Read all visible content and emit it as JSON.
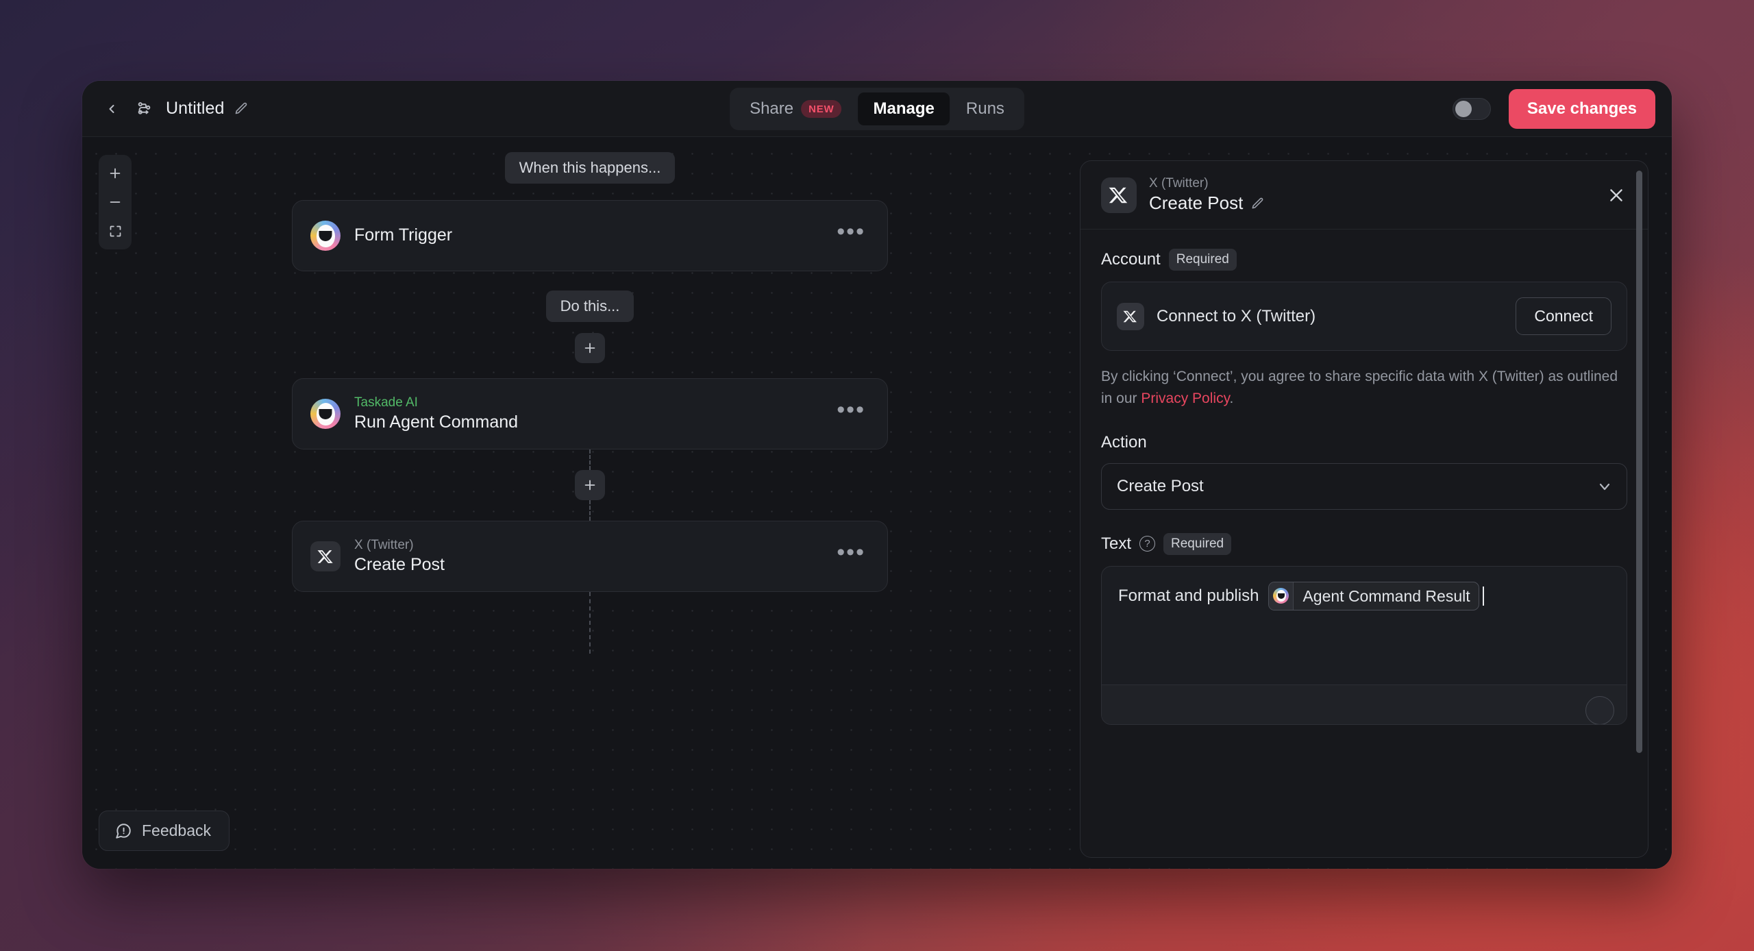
{
  "window": {
    "title": "Untitled"
  },
  "topbar": {
    "back_icon": "chevron-left-icon",
    "flow_icon": "workflow-icon",
    "title": "Untitled",
    "edit_icon": "pencil-icon",
    "tabs": [
      {
        "label": "Share",
        "badge": "NEW",
        "active": false
      },
      {
        "label": "Manage",
        "badge": "",
        "active": true
      },
      {
        "label": "Runs",
        "badge": "",
        "active": false
      }
    ],
    "toggle_state": "off",
    "save_label": "Save changes",
    "save_color": "#eb4a63"
  },
  "canvas": {
    "zoom_controls": {
      "zoom_in": "plus-icon",
      "zoom_out": "minus-icon",
      "fit_view": "fit-screen-icon"
    },
    "trigger_label": "When this happens...",
    "action_label": "Do this...",
    "nodes": [
      {
        "subtitle": "",
        "title": "Form Trigger",
        "icon": "taskade-avatar-icon",
        "menu": "•••"
      },
      {
        "subtitle": "Taskade AI",
        "subtitle_color": "#52b967",
        "title": "Run Agent Command",
        "icon": "taskade-avatar-icon",
        "menu": "•••"
      },
      {
        "subtitle": "X (Twitter)",
        "subtitle_color": "#8d9199",
        "title": "Create Post",
        "icon": "x-twitter-icon",
        "menu": "•••"
      }
    ],
    "add_step_icon": "plus-icon",
    "feedback_label": "Feedback",
    "feedback_icon": "feedback-bubble-icon"
  },
  "panel": {
    "app_name": "X (Twitter)",
    "action_title": "Create Post",
    "edit_icon": "pencil-icon",
    "close_icon": "close-icon",
    "account": {
      "label": "Account",
      "required_badge": "Required",
      "connect_row_label": "Connect to X (Twitter)",
      "connect_button": "Connect",
      "legal_prefix": "By clicking ‘Connect’, you agree to share specific data with X (Twitter) as outlined in our ",
      "legal_link": "Privacy Policy",
      "legal_suffix": ".",
      "link_color": "#e8465f"
    },
    "action": {
      "label": "Action",
      "selected": "Create Post",
      "chevron": "chevron-down-icon"
    },
    "text_field": {
      "label": "Text",
      "help_icon": "question-circle-icon",
      "required_badge": "Required",
      "value_prefix": "Format and publish",
      "token_label": "Agent Command Result",
      "token_icon": "taskade-avatar-icon"
    }
  }
}
